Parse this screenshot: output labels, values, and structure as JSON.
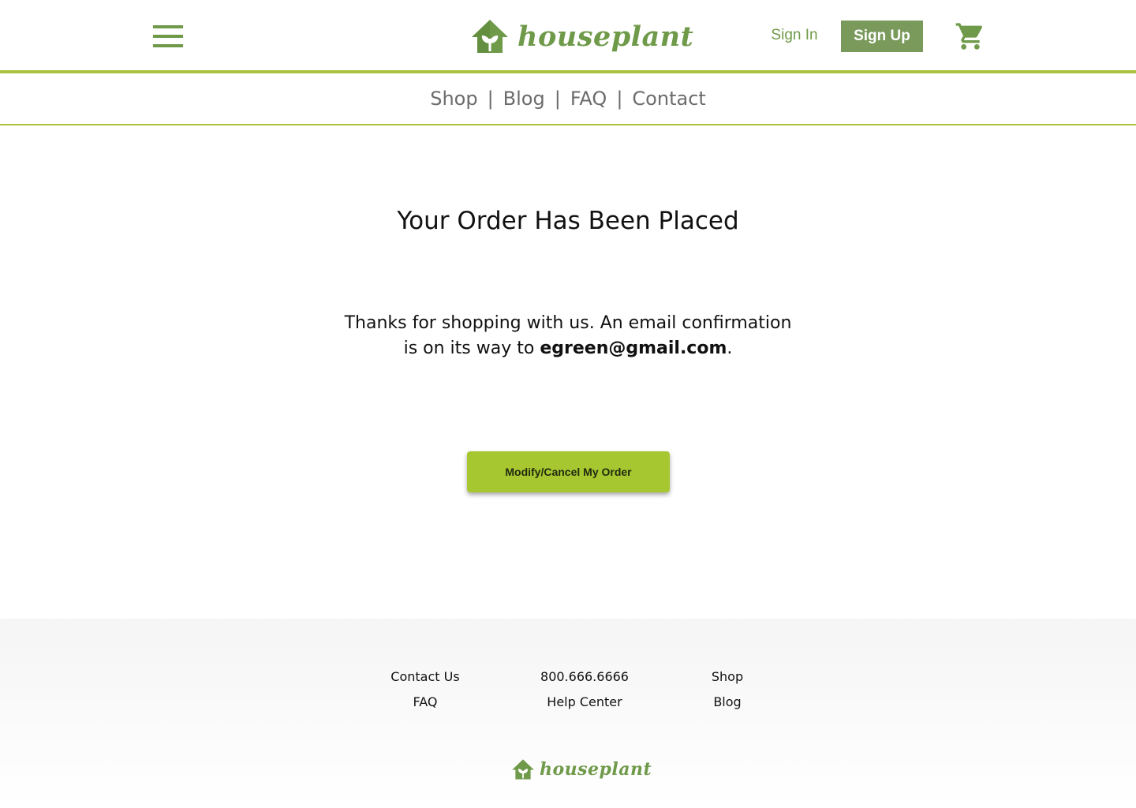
{
  "header": {
    "brand": "houseplant",
    "sign_in": "Sign In",
    "sign_up": "Sign Up",
    "icons": {
      "menu": "hamburger-menu-icon",
      "cart": "shopping-cart-icon",
      "logo": "house-leaf-logo-icon"
    }
  },
  "nav": {
    "items": [
      "Shop",
      "Blog",
      "FAQ",
      "Contact"
    ],
    "separator": "|"
  },
  "main": {
    "title": "Your Order Has Been Placed",
    "message_line1": "Thanks for shopping with us. An email confirmation",
    "message_line2_prefix": "is on its way to ",
    "email": "egreen@gmail.com",
    "message_line2_suffix": ".",
    "cta_label": "Modify/Cancel My Order"
  },
  "footer": {
    "col1": [
      "Contact Us",
      "FAQ"
    ],
    "col2": [
      "800.666.6666",
      "Help Center"
    ],
    "col3": [
      "Shop",
      "Blog"
    ],
    "brand": "houseplant"
  },
  "colors": {
    "brand_green": "#6f9a4a",
    "accent_lime": "#a9c23f",
    "button_green": "#7a9a5c",
    "cta_lime": "#a6c72f"
  }
}
